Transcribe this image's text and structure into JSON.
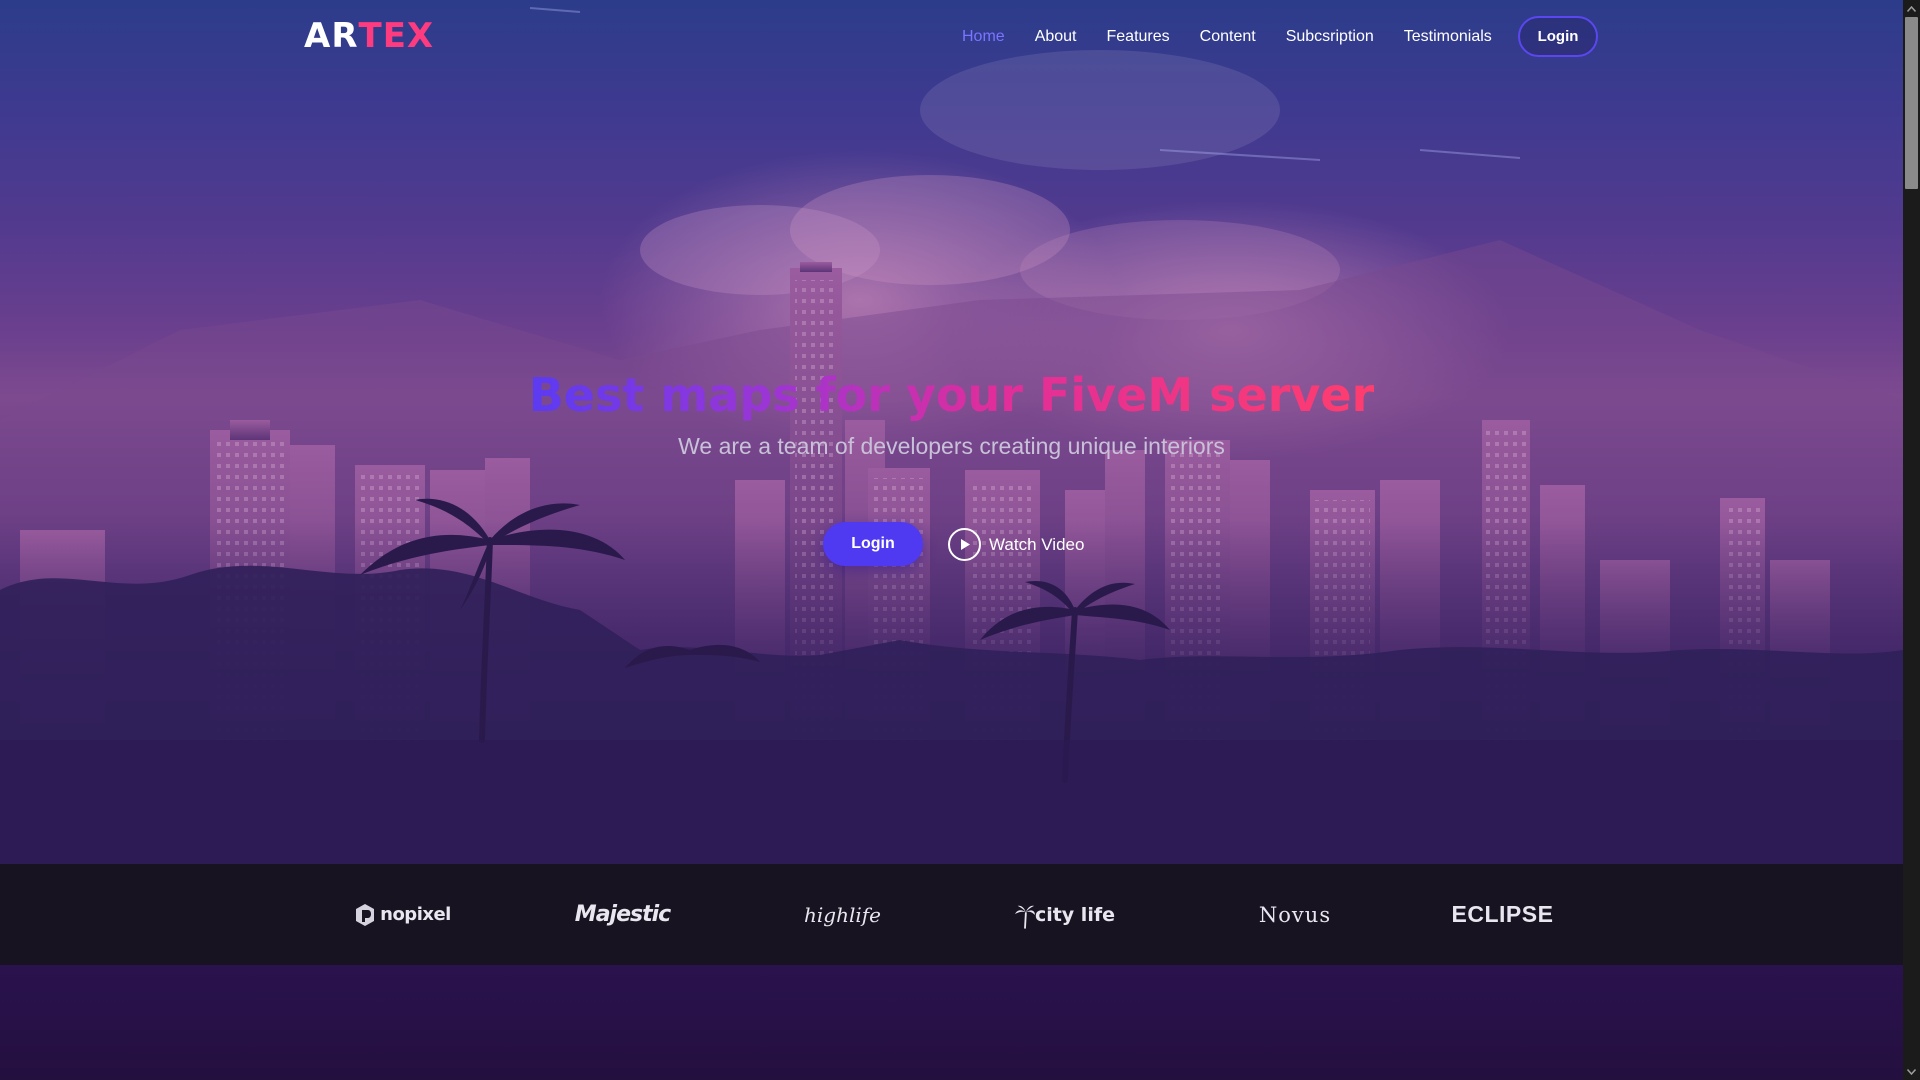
{
  "brand": {
    "logo_main": "AR",
    "logo_accent": "TEX",
    "accent_color": "#ff3b7f"
  },
  "nav": {
    "items": [
      {
        "label": "Home",
        "active": true
      },
      {
        "label": "About",
        "active": false
      },
      {
        "label": "Features",
        "active": false
      },
      {
        "label": "Content",
        "active": false
      },
      {
        "label": "Subcsription",
        "active": false
      },
      {
        "label": "Testimonials",
        "active": false
      }
    ],
    "login_label": "Login",
    "active_color": "#7b74ff"
  },
  "hero": {
    "title": "Best maps for your FiveM server",
    "subtitle": "We are a team of developers creating unique interiors",
    "login_label": "Login",
    "watch_video_label": "Watch Video",
    "primary_color": "#4f3af2"
  },
  "partners": [
    {
      "name": "nopixel",
      "icon": "nopixel-logo"
    },
    {
      "name": "Majestic",
      "icon": "majestic-logo"
    },
    {
      "name": "highlife",
      "icon": "highlife-logo"
    },
    {
      "name": "city life",
      "icon": "citylife-logo"
    },
    {
      "name": "Novus",
      "icon": "novus-logo"
    },
    {
      "name": "ECLIPSE",
      "icon": "eclipse-logo"
    }
  ]
}
